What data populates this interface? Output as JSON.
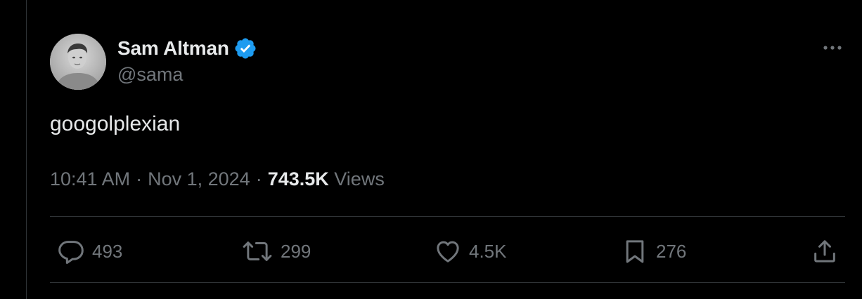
{
  "author": {
    "display_name": "Sam Altman",
    "handle": "@sama",
    "verified": true,
    "verified_badge_color": "#1d9bf0"
  },
  "tweet": {
    "text": "googolplexian",
    "time": "10:41 AM",
    "separator": "·",
    "date": "Nov 1, 2024",
    "views_count": "743.5K",
    "views_label": "Views"
  },
  "actions": {
    "replies": "493",
    "reposts": "299",
    "likes": "4.5K",
    "bookmarks": "276"
  },
  "icons": {
    "more": "more-horizontal-icon",
    "reply": "reply-bubble-icon",
    "repost": "repost-arrows-icon",
    "like": "heart-icon",
    "bookmark": "bookmark-icon",
    "share": "share-upload-icon"
  },
  "colors": {
    "background": "#000000",
    "primary_text": "#e7e9ea",
    "secondary_text": "#71767b",
    "divider": "#2f3336"
  }
}
